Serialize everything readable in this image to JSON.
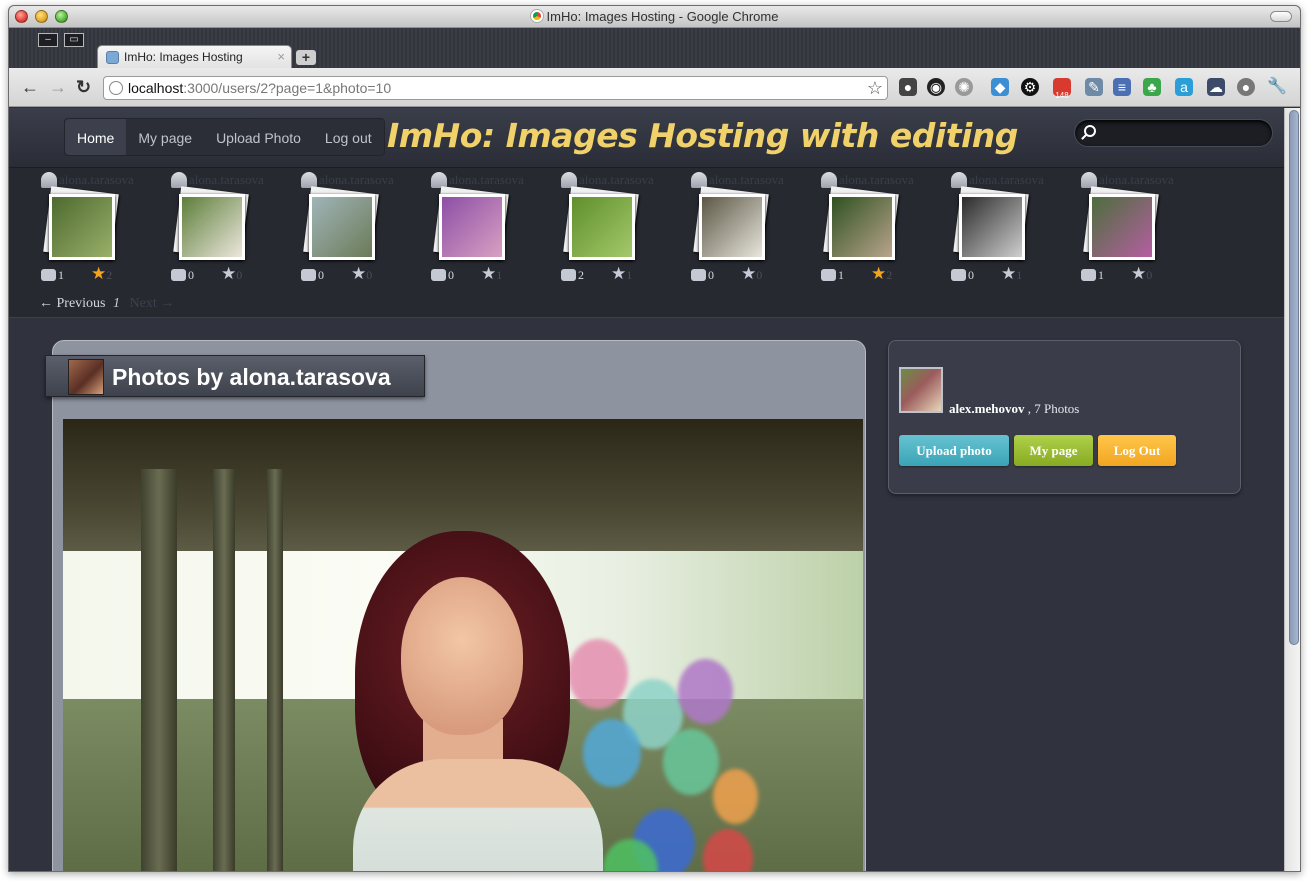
{
  "window": {
    "title": "ImHo: Images Hosting - Google Chrome"
  },
  "tab": {
    "label": "ImHo: Images Hosting",
    "close": "×",
    "new_tab": "+"
  },
  "address_bar": {
    "host": "localhost",
    "path": ":3000/users/2?page=1&photo=10"
  },
  "extensions": {
    "gmail_badge": "148"
  },
  "site": {
    "menu": [
      "Home",
      "My page",
      "Upload Photo",
      "Log out"
    ],
    "logo": "ImHo: Images Hosting with editing",
    "search_placeholder": ""
  },
  "thumbnails": [
    {
      "user": "alona.tarasova",
      "comments": "1",
      "rating": "2",
      "starred": true,
      "colors": [
        "#4d6a2f",
        "#9ab06a"
      ]
    },
    {
      "user": "alona.tarasova",
      "comments": "0",
      "rating": "0",
      "starred": false,
      "colors": [
        "#5d7e3a",
        "#ece7dd"
      ]
    },
    {
      "user": "alona.tarasova",
      "comments": "0",
      "rating": "0",
      "starred": false,
      "colors": [
        "#9fb5b8",
        "#6c7a58"
      ]
    },
    {
      "user": "alona.tarasova",
      "comments": "0",
      "rating": "1",
      "starred": false,
      "colors": [
        "#8c4fa6",
        "#d9a0c2"
      ]
    },
    {
      "user": "alona.tarasova",
      "comments": "2",
      "rating": "1",
      "starred": false,
      "colors": [
        "#5f8f2c",
        "#a4c96a"
      ]
    },
    {
      "user": "alona.tarasova",
      "comments": "0",
      "rating": "0",
      "starred": false,
      "colors": [
        "#5c5744",
        "#e8e6de"
      ]
    },
    {
      "user": "alona.tarasova",
      "comments": "1",
      "rating": "2",
      "starred": true,
      "colors": [
        "#2f5121",
        "#b9a48c"
      ]
    },
    {
      "user": "alona.tarasova",
      "comments": "0",
      "rating": "1",
      "starred": false,
      "colors": [
        "#2b2b2b",
        "#cfcfcf"
      ]
    },
    {
      "user": "alona.tarasova",
      "comments": "1",
      "rating": "0",
      "starred": false,
      "colors": [
        "#4c6e3c",
        "#b65ea2"
      ]
    }
  ],
  "pager": {
    "previous": "← Previous",
    "current": "1",
    "next": "Next →"
  },
  "gallery": {
    "heading": "Photos by alona.tarasova"
  },
  "profile": {
    "username": "alex.mehovov",
    "photos": ", 7 Photos",
    "buttons": {
      "upload": "Upload photo",
      "my_page": "My page",
      "logout": "Log Out"
    }
  },
  "colors": {
    "star_on": "#f4a41c",
    "star_off": "#c7cbd8",
    "logo": "#f1d16a"
  }
}
